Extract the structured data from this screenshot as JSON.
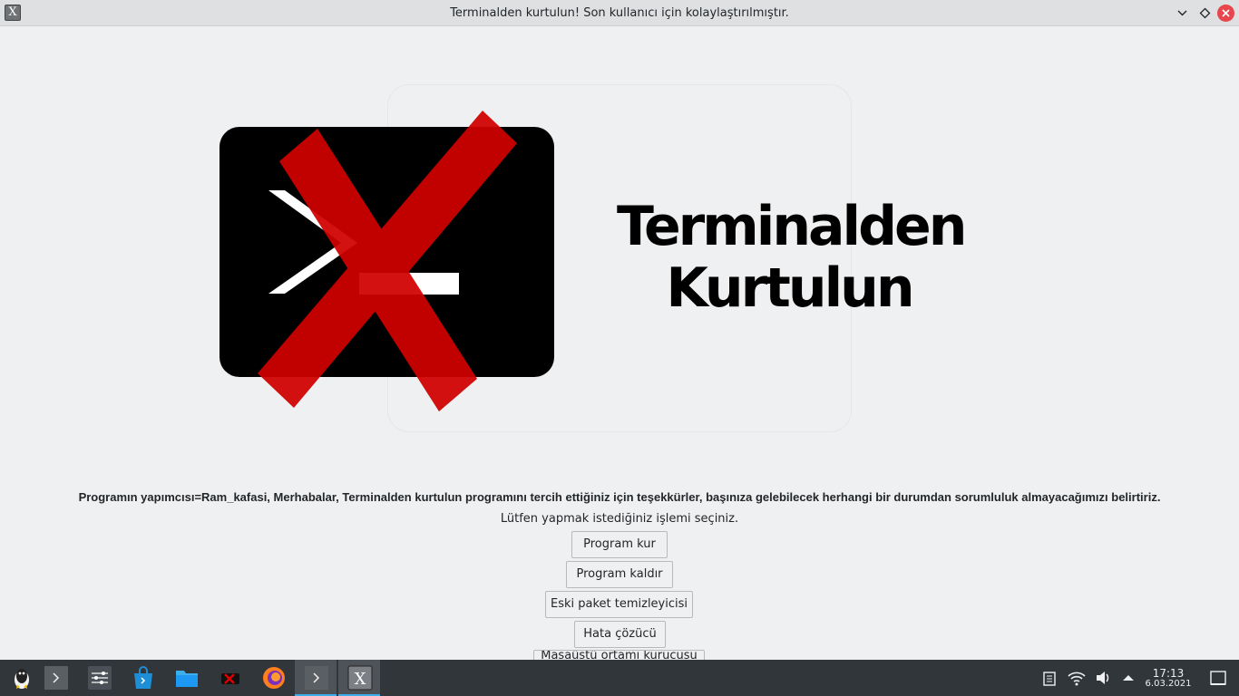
{
  "window": {
    "title": "Terminalden kurtulun! Son kullanıcı için kolaylaştırılmıştır.",
    "app_icon_glyph": "X"
  },
  "logo": {
    "line1": "Terminalden",
    "line2": "Kurtulun",
    "background_color": "#000000",
    "cross_color": "#cc0000"
  },
  "messages": {
    "main": "Programın yapımcısı=Ram_kafasi, Merhabalar, Terminalden kurtulun programını tercih ettiğiniz için teşekkürler, başınıza gelebilecek herhangi bir durumdan sorumluluk almayacağımızı belirtiriz.",
    "sub": "Lütfen yapmak istediğiniz işlemi seçiniz."
  },
  "buttons": {
    "install": "Program kur",
    "remove": "Program kaldır",
    "cleaner": "Eski paket temizleyicisi",
    "fixer": "Hata çözücü",
    "desktop": "Masaüstü ortamı kurucusu"
  },
  "taskbar": {
    "items": [
      "linux-menu-icon",
      "terminal-icon",
      "settings-icon",
      "store-icon",
      "file-manager-icon",
      "app-icon",
      "firefox-icon",
      "terminal-window-icon",
      "active-app-icon"
    ],
    "accent": "#3daee9"
  },
  "clock": {
    "time": "17:13",
    "date": "6.03.2021"
  }
}
